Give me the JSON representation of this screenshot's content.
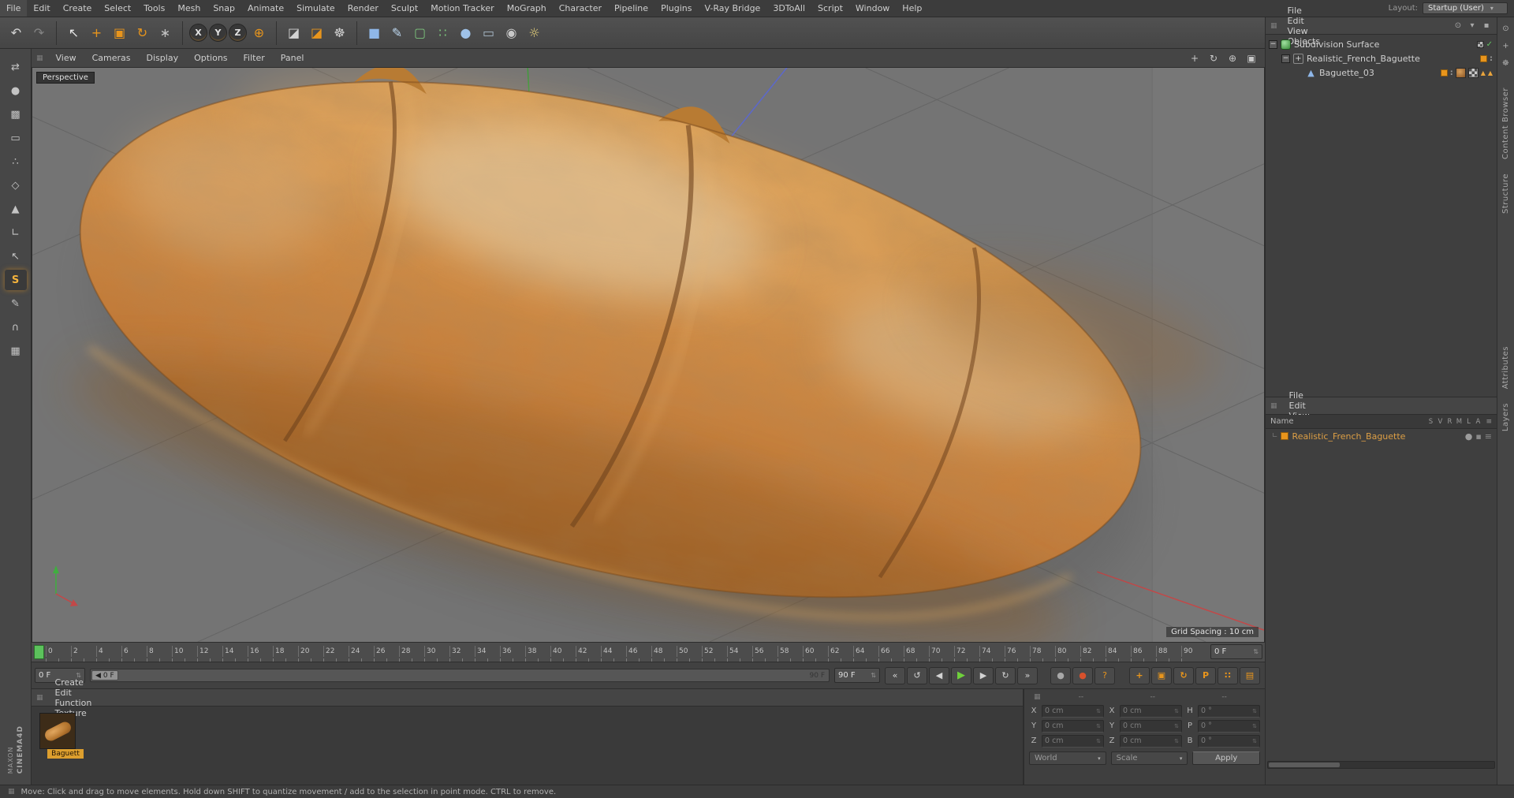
{
  "app": {
    "layout_label": "Layout:",
    "layout_value": "Startup (User)",
    "brand_top": "MAXON",
    "brand_bottom": "CINEMA4D"
  },
  "colors": {
    "accent": "#e8951c",
    "viewport_bg": "#747474",
    "play_green": "#6fd03c",
    "marker_green": "#5cc25c"
  },
  "menubar": [
    "File",
    "Edit",
    "Create",
    "Select",
    "Tools",
    "Mesh",
    "Snap",
    "Animate",
    "Simulate",
    "Render",
    "Sculpt",
    "Motion Tracker",
    "MoGraph",
    "Character",
    "Pipeline",
    "Plugins",
    "V-Ray Bridge",
    "3DToAll",
    "Script",
    "Window",
    "Help"
  ],
  "toolbar": {
    "groups": [
      [
        {
          "name": "undo",
          "glyph": "↶",
          "c": "#d2d2d2"
        },
        {
          "name": "redo",
          "glyph": "↷",
          "c": "#838383"
        }
      ],
      [
        {
          "name": "live-selection",
          "glyph": "↖",
          "c": "#e8e8e8"
        },
        {
          "name": "move-tool",
          "glyph": "+",
          "c": "#e8951c"
        },
        {
          "name": "scale-tool",
          "glyph": "▣",
          "c": "#e8951c"
        },
        {
          "name": "rotate-tool",
          "glyph": "↻",
          "c": "#e8951c"
        },
        {
          "name": "last-used-tool",
          "glyph": "∗",
          "c": "#c2c2c2"
        }
      ],
      [
        {
          "name": "lock-x-axis",
          "glyph": "X",
          "shape": "circle"
        },
        {
          "name": "lock-y-axis",
          "glyph": "Y",
          "shape": "circle"
        },
        {
          "name": "lock-z-axis",
          "glyph": "Z",
          "shape": "circle"
        },
        {
          "name": "coordinate-system",
          "glyph": "⊕",
          "c": "#e8951c"
        }
      ],
      [
        {
          "name": "render-view",
          "glyph": "◪",
          "c": "#d2d2d2"
        },
        {
          "name": "render-picture-viewer",
          "glyph": "◪",
          "c": "#e8951c"
        },
        {
          "name": "render-settings",
          "glyph": "☸",
          "c": "#d2d2d2"
        }
      ],
      [
        {
          "name": "add-cube",
          "glyph": "■",
          "c": "#8fb7e8"
        },
        {
          "name": "add-spline-pen",
          "glyph": "✎",
          "c": "#bcd6ee"
        },
        {
          "name": "add-subdivision-surface",
          "glyph": "▢",
          "c": "#7cc47c"
        },
        {
          "name": "add-cloner",
          "glyph": "∷",
          "c": "#7cc47c"
        },
        {
          "name": "add-metaball",
          "glyph": "●",
          "c": "#9fc2e8"
        },
        {
          "name": "add-floor",
          "glyph": "▭",
          "c": "#a8bac8"
        },
        {
          "name": "add-camera",
          "glyph": "◉",
          "c": "#c8c8c8"
        },
        {
          "name": "add-light",
          "glyph": "☼",
          "c": "#e8d27c"
        }
      ]
    ]
  },
  "sidebar": [
    {
      "name": "make-editable",
      "glyph": "⇄"
    },
    {
      "name": "model-mode",
      "glyph": "●"
    },
    {
      "name": "texture-mode",
      "glyph": "▩"
    },
    {
      "name": "workplane-mode",
      "glyph": "▭"
    },
    {
      "name": "points-mode",
      "glyph": "∴"
    },
    {
      "name": "edges-mode",
      "glyph": "◇"
    },
    {
      "name": "polygons-mode",
      "glyph": "▲"
    },
    {
      "name": "enable-axis-mode",
      "glyph": "∟"
    },
    {
      "name": "tweak-mode",
      "glyph": "↖"
    },
    {
      "name": "viewport-solo",
      "glyph": "S",
      "active": true
    },
    {
      "name": "texture-paint",
      "glyph": "✎"
    },
    {
      "name": "enable-snap",
      "glyph": "∩"
    },
    {
      "name": "quantize-snap",
      "glyph": "▦"
    }
  ],
  "viewport": {
    "menu": [
      "View",
      "Cameras",
      "Display",
      "Options",
      "Filter",
      "Panel"
    ],
    "nav_icons": [
      {
        "name": "pan-view-icon",
        "glyph": "+"
      },
      {
        "name": "orbit-view-icon",
        "glyph": "↻"
      },
      {
        "name": "zoom-view-icon",
        "glyph": "⊕"
      },
      {
        "name": "toggle-view-icon",
        "glyph": "▣"
      }
    ],
    "camera_label": "Perspective",
    "grid_spacing": "Grid Spacing : 10 cm"
  },
  "timeline": {
    "ticks": [
      0,
      2,
      4,
      6,
      8,
      10,
      12,
      14,
      16,
      18,
      20,
      22,
      24,
      26,
      28,
      30,
      32,
      34,
      36,
      38,
      40,
      42,
      44,
      46,
      48,
      50,
      52,
      54,
      56,
      58,
      60,
      62,
      64,
      66,
      68,
      70,
      72,
      74,
      76,
      78,
      80,
      82,
      84,
      86,
      88,
      90
    ],
    "ruler_frame": "0 F"
  },
  "transport": {
    "current_frame": "0 F",
    "slider_start": "0 F",
    "slider_end": "90 F",
    "end_frame": "90 F",
    "buttons": [
      {
        "name": "goto-start",
        "glyph": "«"
      },
      {
        "name": "play-backwards",
        "glyph": "↺"
      },
      {
        "name": "previous-frame",
        "glyph": "◀"
      },
      {
        "name": "play-forwards",
        "glyph": "▶",
        "green": true
      },
      {
        "name": "next-frame",
        "glyph": "▶"
      },
      {
        "name": "loop-playback",
        "glyph": "↻"
      },
      {
        "name": "goto-end",
        "glyph": "»"
      }
    ],
    "record": [
      {
        "name": "record-keyframe",
        "glyph": "●",
        "c": "#a8a8a8"
      },
      {
        "name": "autokeying",
        "glyph": "●",
        "c": "#d8512c"
      },
      {
        "name": "keyframe-selection",
        "glyph": "?",
        "c": "#e8951c"
      }
    ],
    "keyflags": [
      {
        "name": "key-position",
        "glyph": "+"
      },
      {
        "name": "key-scale",
        "glyph": "▣"
      },
      {
        "name": "key-rotation",
        "glyph": "↻"
      },
      {
        "name": "key-parameter",
        "glyph": "P"
      },
      {
        "name": "key-point-level",
        "glyph": "∷"
      },
      {
        "name": "key-timeline",
        "glyph": "▤"
      }
    ]
  },
  "object_manager": {
    "menu": [
      "File",
      "Edit",
      "View",
      "Objects"
    ],
    "menu_icons": [
      {
        "name": "om-search-icon",
        "glyph": "⊙"
      },
      {
        "name": "om-filter-icon",
        "glyph": "▾"
      },
      {
        "name": "om-lock-icon",
        "glyph": "▪"
      }
    ],
    "tree": [
      {
        "label": "Subdivision Surface",
        "depth": 0,
        "icon": "subdiv",
        "expander": true,
        "badges": [
          "checker",
          "check"
        ]
      },
      {
        "label": "Realistic_French_Baguette",
        "depth": 1,
        "icon": "nullobj",
        "expander": true,
        "badges": [
          "orange",
          "dots"
        ]
      },
      {
        "label": "Baguette_03",
        "depth": 2,
        "icon": "poly",
        "expander": false,
        "badges": [
          "orange",
          "dots",
          "tex",
          "uv",
          "tri",
          "tri"
        ]
      }
    ]
  },
  "materials_panel": {
    "menu": [
      "File",
      "Edit",
      "View"
    ],
    "name_header": "Name",
    "columns": [
      "S",
      "V",
      "R",
      "M",
      "L",
      "A"
    ],
    "row": {
      "label": "Realistic_French_Baguette"
    },
    "row_icons": [
      {
        "name": "material-preview-icon",
        "glyph": "●",
        "c": "#9c9c9c"
      },
      {
        "name": "material-render-icon",
        "glyph": "▪",
        "c": "#8a8a8a"
      },
      {
        "name": "material-more-icon",
        "glyph": "≡",
        "c": "#8a8a8a"
      }
    ]
  },
  "material_browser": {
    "menu": [
      "Create",
      "Edit",
      "Function",
      "Texture"
    ],
    "selected_label": "Baguett"
  },
  "coordinates": {
    "headers": [
      "--",
      "--",
      "--"
    ],
    "rows": [
      {
        "labels": [
          "X",
          "X",
          "H"
        ],
        "values": [
          "0 cm",
          "0 cm",
          "0 °"
        ]
      },
      {
        "labels": [
          "Y",
          "Y",
          "P"
        ],
        "values": [
          "0 cm",
          "0 cm",
          "0 °"
        ]
      },
      {
        "labels": [
          "Z",
          "Z",
          "B"
        ],
        "values": [
          "0 cm",
          "0 cm",
          "0 °"
        ]
      }
    ],
    "dropdown1": "World",
    "dropdown2": "Scale",
    "apply": "Apply"
  },
  "right_strip": {
    "icons": [
      {
        "name": "strip-search-icon",
        "glyph": "⊙"
      },
      {
        "name": "strip-add-icon",
        "glyph": "+"
      },
      {
        "name": "strip-gear-icon",
        "glyph": "☸"
      }
    ],
    "tabs": [
      "Content Browser",
      "Structure",
      "Attributes",
      "Layers"
    ]
  },
  "status": {
    "text": "Move: Click and drag to move elements. Hold down SHIFT to quantize movement / add to the selection in point mode. CTRL to remove."
  }
}
